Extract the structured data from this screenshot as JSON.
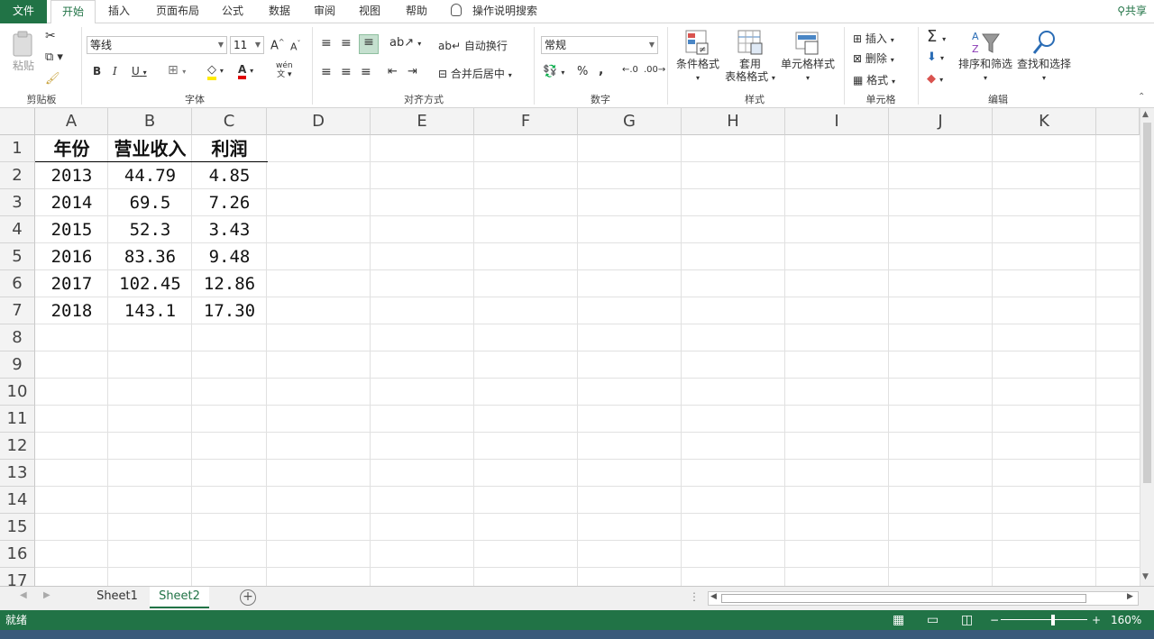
{
  "ribbon_tabs": [
    "文件",
    "开始",
    "插入",
    "页面布局",
    "公式",
    "数据",
    "审阅",
    "视图",
    "帮助"
  ],
  "tell_me": "操作说明搜索",
  "share": "共享",
  "clipboard": {
    "paste": "粘贴",
    "group": "剪贴板"
  },
  "font": {
    "name": "等线",
    "size": "11",
    "grow": "A",
    "shrink": "A",
    "bold": "B",
    "italic": "I",
    "underline": "U",
    "phonetic": "wén",
    "group": "字体"
  },
  "alignment": {
    "wrap": "自动换行",
    "merge": "合并后居中",
    "group": "对齐方式"
  },
  "number": {
    "format": "常规",
    "percent": "%",
    "comma": ",",
    "inc_decimal": ".00→.0",
    "group": "数字"
  },
  "styles": {
    "conditional": "条件格式",
    "table_a": "套用",
    "table_b": "表格格式",
    "cell_styles": "单元格样式",
    "group": "样式"
  },
  "cells": {
    "insert": "插入",
    "delete": "删除",
    "format": "格式",
    "group": "单元格"
  },
  "editing": {
    "sort": "排序和筛选",
    "find": "查找和选择",
    "group": "编辑"
  },
  "columns": [
    "A",
    "B",
    "C",
    "D",
    "E",
    "F",
    "G",
    "H",
    "I",
    "J",
    "K"
  ],
  "rows": [
    "1",
    "2",
    "3",
    "4",
    "5",
    "6",
    "7",
    "8",
    "9",
    "10",
    "11",
    "12",
    "13",
    "14",
    "15",
    "16",
    "17"
  ],
  "table": {
    "headers": [
      "年份",
      "营业收入",
      "利润"
    ],
    "data": [
      [
        "2013",
        "44.79",
        "4.85"
      ],
      [
        "2014",
        "69.5",
        "7.26"
      ],
      [
        "2015",
        "52.3",
        "3.43"
      ],
      [
        "2016",
        "83.36",
        "9.48"
      ],
      [
        "2017",
        "102.45",
        "12.86"
      ],
      [
        "2018",
        "143.1",
        "17.30"
      ]
    ]
  },
  "sheets": [
    "Sheet1",
    "Sheet2"
  ],
  "active_sheet": "Sheet2",
  "status": {
    "ready": "就绪",
    "zoom": "160%"
  }
}
